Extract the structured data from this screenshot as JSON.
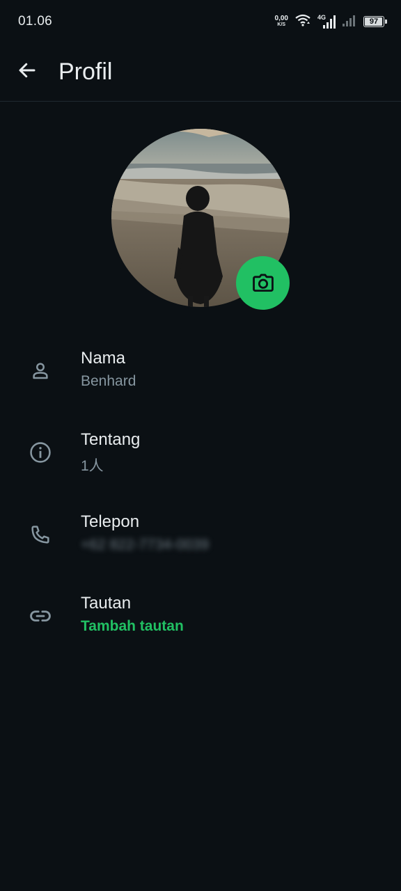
{
  "status_bar": {
    "time": "01.06",
    "net_speed_value": "0,00",
    "net_speed_unit": "K/S",
    "network_type": "4G",
    "battery_level": "97",
    "battery_fraction": 0.97
  },
  "header": {
    "title": "Profil",
    "back_icon": "arrow-left-icon"
  },
  "profile": {
    "photo_icon": "camera-icon",
    "accent_color": "#21c063"
  },
  "rows": [
    {
      "icon": "person-icon",
      "label": "Nama",
      "value": "Benhard"
    },
    {
      "icon": "info-icon",
      "label": "Tentang",
      "value": "1人"
    },
    {
      "icon": "phone-icon",
      "label": "Telepon",
      "value": "+62 822-7734-0039"
    },
    {
      "icon": "link-icon",
      "label": "Tautan",
      "value": "Tambah tautan"
    }
  ]
}
